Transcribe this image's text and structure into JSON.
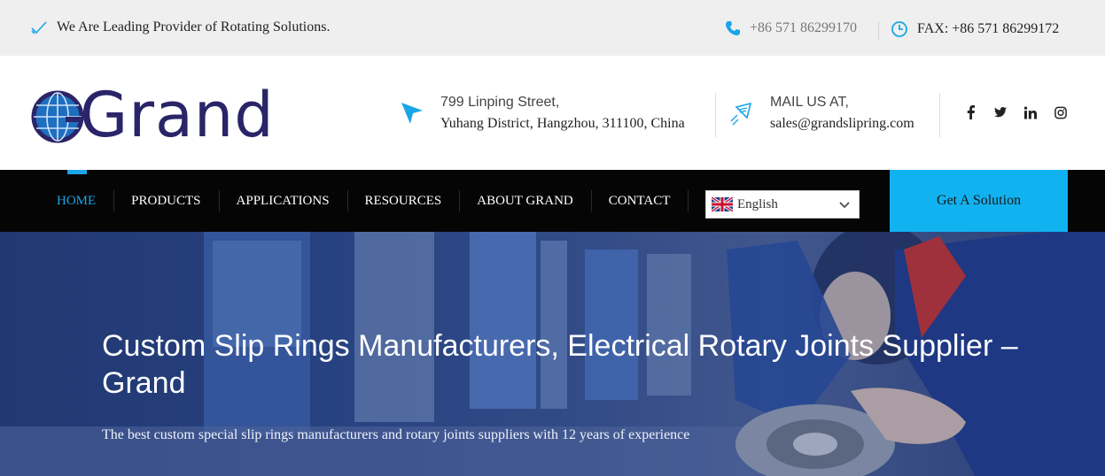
{
  "topbar": {
    "tagline": "We Are Leading Provider of Rotating Solutions.",
    "phone": "+86 571 86299170",
    "fax": "FAX: +86 571 86299172"
  },
  "header": {
    "logo_text": "Grand",
    "address_line1": "799 Linping Street,",
    "address_line2": "Yuhang District, Hangzhou, 311100, China",
    "mail_label": "MAIL US AT,",
    "mail_value": "sales@grandslipring.com",
    "social_icons": [
      "facebook-icon",
      "twitter-icon",
      "linkedin-icon",
      "instagram-icon"
    ]
  },
  "nav": {
    "items": [
      {
        "label": "HOME",
        "active": true
      },
      {
        "label": "PRODUCTS"
      },
      {
        "label": "APPLICATIONS"
      },
      {
        "label": "RESOURCES"
      },
      {
        "label": "ABOUT GRAND"
      },
      {
        "label": "CONTACT"
      }
    ],
    "language": "English",
    "cta": "Get A Solution"
  },
  "hero": {
    "title": "Custom Slip Rings Manufacturers, Electrical Rotary Joints Supplier – Grand",
    "subtitle": "The best custom special slip rings manufacturers and rotary joints suppliers with 12 years of experience"
  },
  "colors": {
    "accent": "#1aa5e8",
    "cta_bg": "#11b2f0",
    "brand": "#2a2468",
    "nav_bg": "#050505"
  }
}
